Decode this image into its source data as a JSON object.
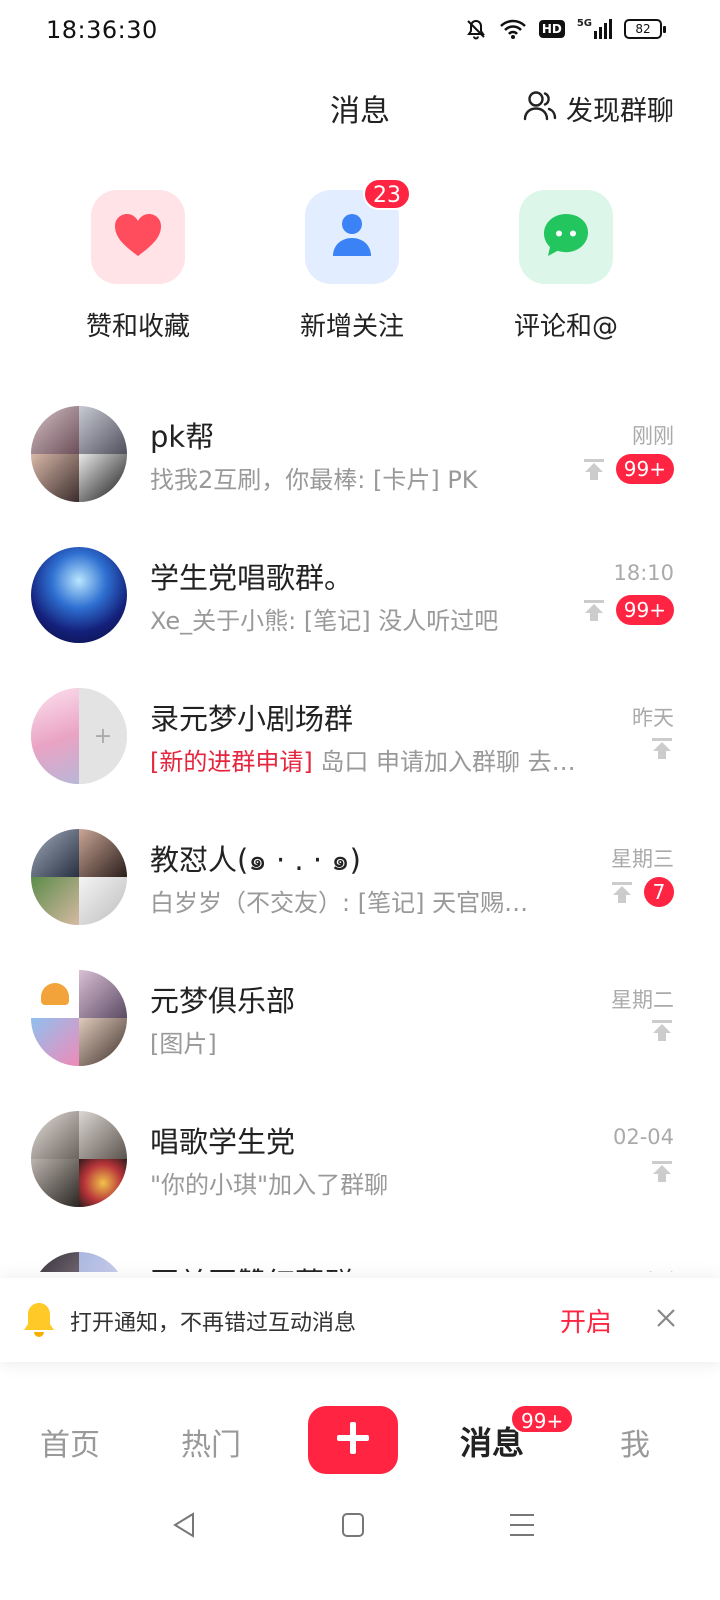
{
  "status_bar": {
    "time": "18:36:30",
    "network": "5G",
    "hd": "HD",
    "battery": "82"
  },
  "header": {
    "title": "消息",
    "discover_label": "发现群聊"
  },
  "shortcuts": [
    {
      "label": "赞和收藏",
      "icon": "heart-icon",
      "color": "#ff4d5e"
    },
    {
      "label": "新增关注",
      "icon": "person-icon",
      "color": "#3b82f6",
      "badge": "23"
    },
    {
      "label": "评论和@",
      "icon": "chat-bubble-icon",
      "color": "#22c55e"
    }
  ],
  "conversations": [
    {
      "name": "pk帮",
      "preview": "找我2互刷，你最棒: [卡片] PK",
      "time": "刚刚",
      "badge": "99+"
    },
    {
      "name": "学生党唱歌群。",
      "preview": "Xe_关于小熊: [笔记] 没人听过吧",
      "time": "18:10",
      "badge": "99+"
    },
    {
      "name": "录元梦小剧场群",
      "tag": "[新的进群申请]",
      "preview": " 岛口 申请加入群聊 去…",
      "time": "昨天"
    },
    {
      "name": "教怼人(๑ · . · ๑)",
      "preview": "白岁岁（不交友）: [笔记] 天官赐…",
      "time": "星期三",
      "badge": "7"
    },
    {
      "name": "元梦俱乐部",
      "preview": "[图片]",
      "time": "星期二"
    },
    {
      "name": "唱歌学生党",
      "preview": "\"你的小琪\"加入了群聊",
      "time": "02-04"
    },
    {
      "name": "互关互赞红薯群",
      "preview": "",
      "time": "刚刚"
    }
  ],
  "notification": {
    "text": "打开通知，不再错过互动消息",
    "action": "开启"
  },
  "bottom_nav": {
    "home": "首页",
    "hot": "热门",
    "messages": "消息",
    "me": "我",
    "messages_badge": "99+"
  },
  "accent_color": "#ff2442"
}
